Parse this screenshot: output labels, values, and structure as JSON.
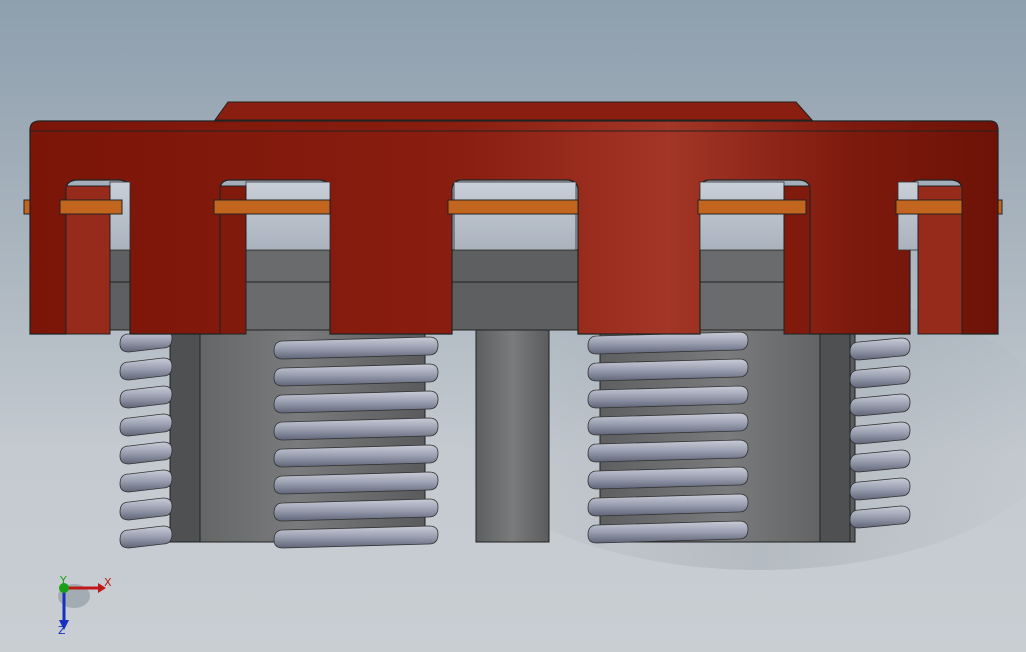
{
  "viewport": {
    "background_top": "#8e9fae",
    "background_bottom": "#c9ced3"
  },
  "model": {
    "part_color": "#7d1a0e",
    "part_highlight": "#a33626",
    "spring_color": "#8f94a6",
    "body_color": "#6f7071",
    "pin_color": "#c2661f"
  },
  "triad": {
    "x_label": "X",
    "y_label": "Y",
    "z_label": "Z",
    "x_color": "#c01818",
    "y_color": "#18a018",
    "z_color": "#1830c0"
  }
}
